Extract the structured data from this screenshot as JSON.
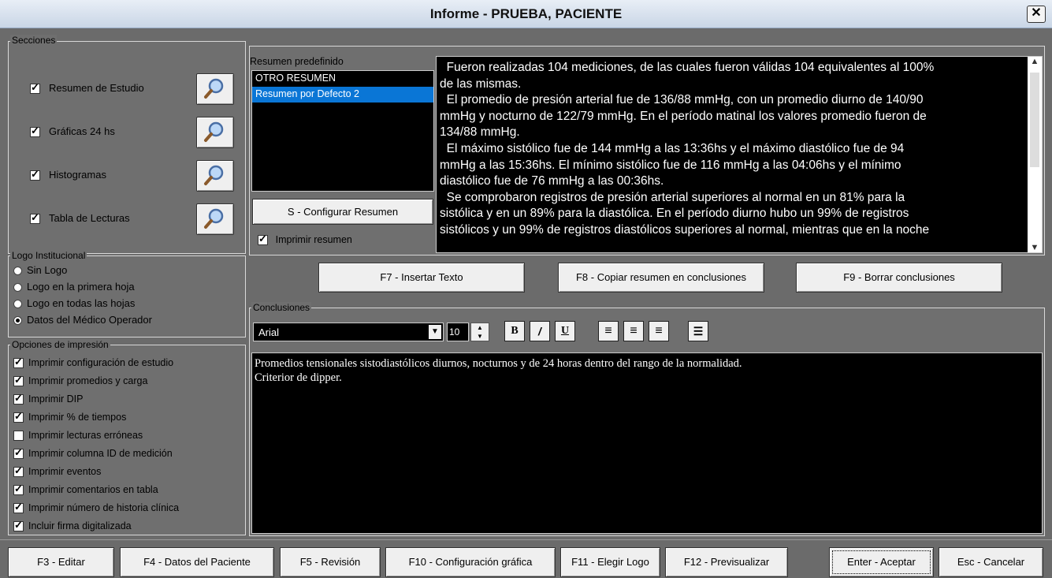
{
  "window": {
    "title": "Informe - PRUEBA, PACIENTE",
    "close_glyph": "✕"
  },
  "secciones": {
    "legend": "Secciones",
    "items": [
      {
        "label": "Resumen de Estudio",
        "checked": true
      },
      {
        "label": "Gráficas 24 hs",
        "checked": true
      },
      {
        "label": "Histogramas",
        "checked": true
      },
      {
        "label": "Tabla de Lecturas",
        "checked": true
      }
    ]
  },
  "logo": {
    "legend": "Logo Institucional",
    "options": [
      {
        "label": "Sin Logo",
        "selected": false
      },
      {
        "label": "Logo en la primera hoja",
        "selected": false
      },
      {
        "label": "Logo en todas las hojas",
        "selected": false
      },
      {
        "label": "Datos del Médico Operador",
        "selected": true
      }
    ]
  },
  "impresion": {
    "legend": "Opciones de impresión",
    "options": [
      {
        "label": "Imprimir configuración de estudio",
        "checked": true
      },
      {
        "label": "Imprimir promedios y carga",
        "checked": true
      },
      {
        "label": "Imprimir DIP",
        "checked": true
      },
      {
        "label": "Imprimir % de tiempos",
        "checked": true
      },
      {
        "label": "Imprimir lecturas erróneas",
        "checked": false
      },
      {
        "label": "Imprimir columna ID de medición",
        "checked": true
      },
      {
        "label": "Imprimir eventos",
        "checked": true
      },
      {
        "label": "Imprimir comentarios en tabla",
        "checked": true
      },
      {
        "label": "Imprimir número de historia clínica",
        "checked": true
      },
      {
        "label": "Incluir firma digitalizada",
        "checked": true
      }
    ]
  },
  "resumen": {
    "label": "Resumen predefinido",
    "list": [
      {
        "label": "OTRO RESUMEN",
        "selected": false
      },
      {
        "label": "Resumen por Defecto 2",
        "selected": true
      }
    ],
    "configure_button": "S - Configurar Resumen",
    "print_checkbox": "Imprimir resumen",
    "text_lines": [
      "  Fueron realizadas 104 mediciones, de las cuales fueron válidas 104 equivalentes al 100%",
      "de las mismas.",
      "  El promedio de presión arterial fue de 136/88 mmHg, con un promedio diurno de 140/90",
      "mmHg y nocturno de 122/79 mmHg. En el período matinal los valores promedio fueron de",
      "134/88 mmHg.",
      "  El máximo sistólico fue de 144 mmHg a las 13:36hs y el máximo diastólico fue de 94",
      "mmHg a las 15:36hs. El mínimo sistólico fue de 116 mmHg a las 04:06hs y el mínimo",
      "diastólico fue de 76 mmHg a las 00:36hs.",
      "  Se comprobaron registros de presión arterial superiores al normal en un 81% para la",
      "sistólica y en un 89% para la diastólica. En el período diurno hubo un 99% de registros",
      "sistólicos y un 99% de registros diastólicos superiores al normal, mientras que en la noche"
    ]
  },
  "actions": {
    "insert": "F7 - Insertar Texto",
    "copy": "F8 - Copiar resumen en conclusiones",
    "clear": "F9 - Borrar conclusiones"
  },
  "conclusiones": {
    "legend": "Conclusiones",
    "font": "Arial",
    "size": "10",
    "lines": [
      "Promedios tensionales sistodiastólicos diurnos, nocturnos y de 24  horas dentro del rango de la normalidad.",
      "Criterior de dipper."
    ]
  },
  "footer": {
    "edit": "F3 - Editar",
    "patient": "F4 - Datos del Paciente",
    "review": "F5 - Revisión",
    "graph": "F10 - Configuración gráfica",
    "logo": "F11 - Elegir Logo",
    "preview": "F12 - Previsualizar",
    "accept": "Enter - Aceptar",
    "cancel": "Esc - Cancelar"
  }
}
